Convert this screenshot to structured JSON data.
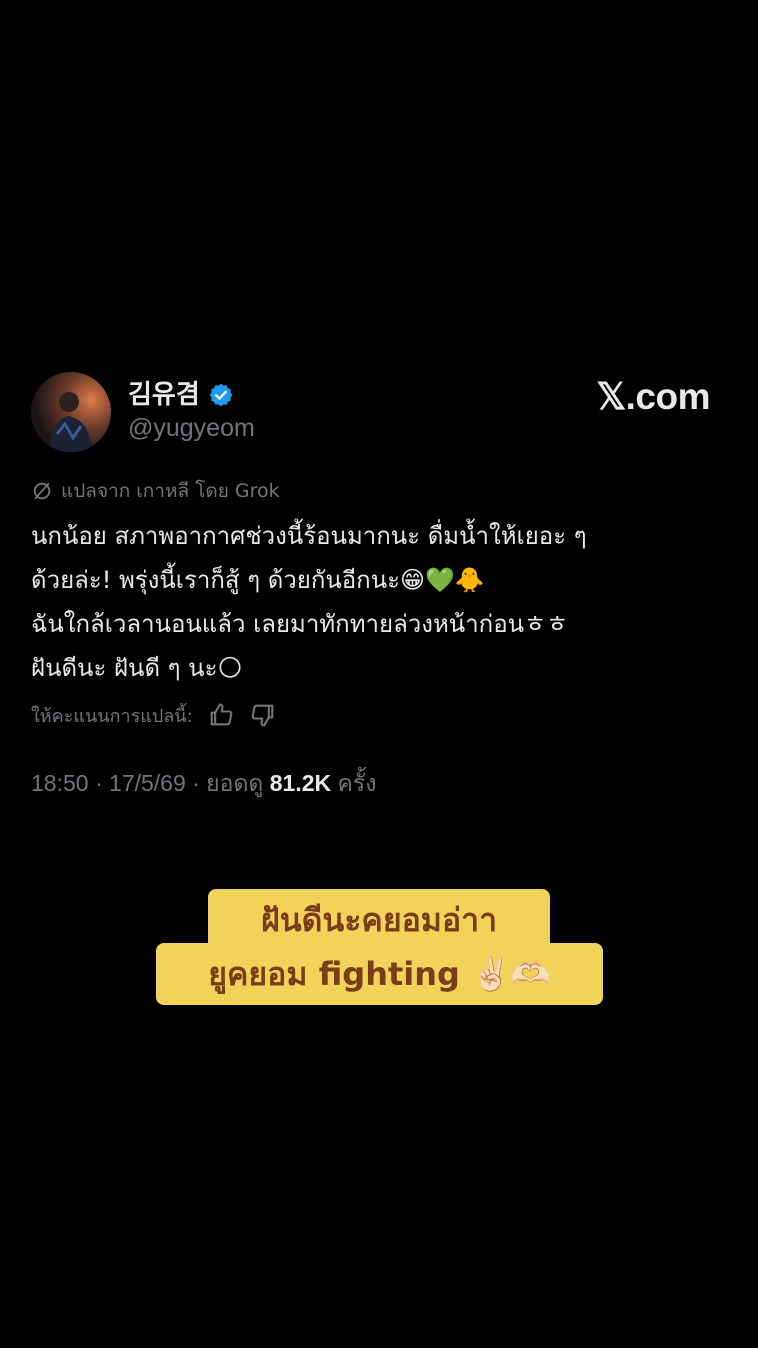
{
  "author": {
    "display_name": "김유겸",
    "handle": "@yugyeom",
    "verified": true
  },
  "brand": "𝕏.com",
  "translation": {
    "label": "แปลจาก เกาหลี โดย Grok"
  },
  "tweet": {
    "lines": [
      "นกน้อย สภาพอากาศช่วงนี้ร้อนมากนะ ดื่มน้ำให้เยอะ ๆ",
      "ด้วยล่ะ! พรุ่งนี้เราก็สู้ ๆ ด้วยกันอีกนะ😁💚🐥",
      "ฉันใกล้เวลานอนแล้ว เลยมาทักทายล่วงหน้าก่อนㅎㅎ",
      "ฝันดีนะ ฝันดี ๆ นะ🌕"
    ]
  },
  "rating": {
    "label": "ให้คะแนนการแปลนี้:"
  },
  "meta": {
    "time_date": "18:50 · 17/5/69 · ยอดดู ",
    "views": "81.2K",
    "views_suffix": " ครั้ง"
  },
  "caption": {
    "line1": "ฝันดีนะคยอมอ่าา",
    "line2": "ยูคยอม fighting ✌🏻🫶🏻"
  },
  "colors": {
    "background": "#000000",
    "text_primary": "#e7e9ea",
    "text_secondary": "#71767b",
    "verified_blue": "#1d9bf0",
    "caption_bg": "#f2d35a",
    "caption_text": "#7a3c1a"
  }
}
